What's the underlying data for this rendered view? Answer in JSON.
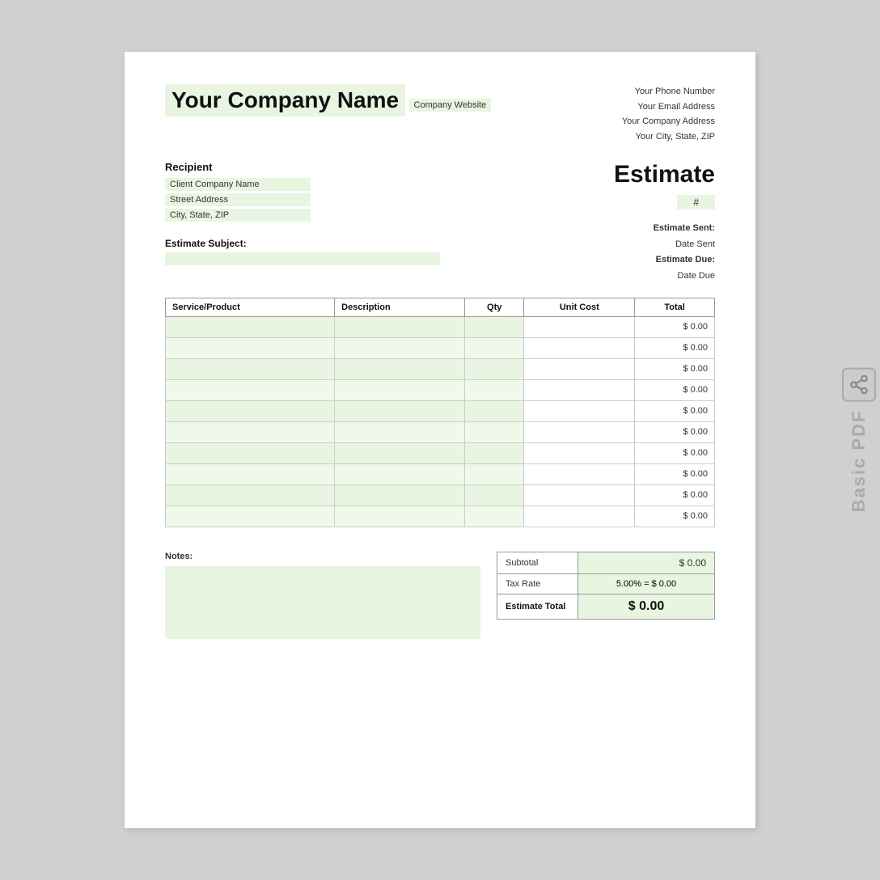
{
  "side_tab": {
    "text": "Basic PDF"
  },
  "header": {
    "company_name": "Your Company Name",
    "company_website": "Company Website",
    "phone": "Your Phone Number",
    "email": "Your Email Address",
    "address": "Your Company Address",
    "city_state_zip": "Your City, State, ZIP"
  },
  "recipient": {
    "label": "Recipient",
    "company": "Client Company Name",
    "street": "Street Address",
    "city": "City, State, ZIP"
  },
  "estimate": {
    "title": "Estimate",
    "number_placeholder": "#",
    "sent_label": "Estimate Sent:",
    "sent_value": "Date Sent",
    "due_label": "Estimate Due:",
    "due_value": "Date Due"
  },
  "subject": {
    "label": "Estimate Subject:"
  },
  "table": {
    "headers": [
      "Service/Product",
      "Description",
      "Qty",
      "Unit Cost",
      "Total"
    ],
    "rows": [
      {
        "total": "$ 0.00"
      },
      {
        "total": "$ 0.00"
      },
      {
        "total": "$ 0.00"
      },
      {
        "total": "$ 0.00"
      },
      {
        "total": "$ 0.00"
      },
      {
        "total": "$ 0.00"
      },
      {
        "total": "$ 0.00"
      },
      {
        "total": "$ 0.00"
      },
      {
        "total": "$ 0.00"
      },
      {
        "total": "$ 0.00"
      }
    ]
  },
  "notes": {
    "label": "Notes:"
  },
  "summary": {
    "subtotal_label": "Subtotal",
    "subtotal_value": "$ 0.00",
    "tax_label": "Tax Rate",
    "tax_rate": "5.00%",
    "tax_equals": "=",
    "tax_value": "$ 0.00",
    "total_label": "Estimate Total",
    "total_value": "$ 0.00"
  }
}
